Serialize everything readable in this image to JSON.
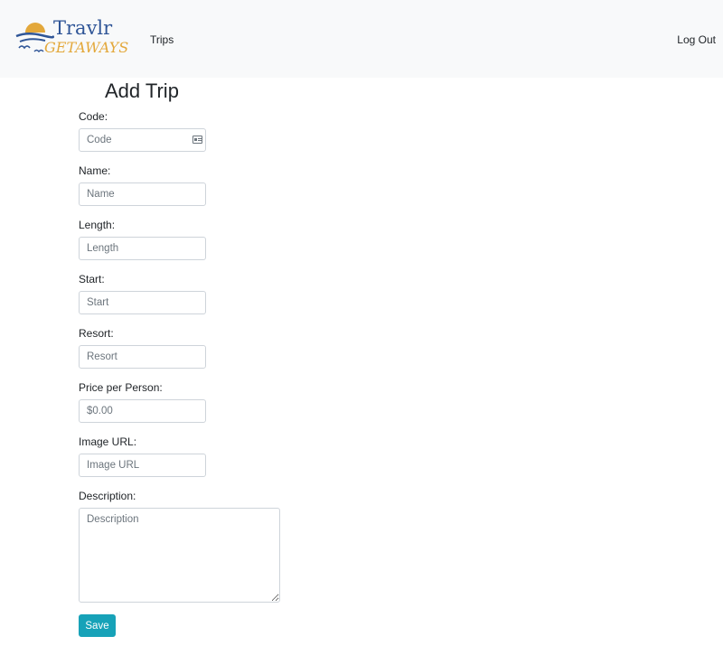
{
  "navbar": {
    "brand": {
      "line1": "Travlr",
      "line2": "GETAWAYS"
    },
    "links": {
      "trips": "Trips",
      "logout": "Log Out"
    }
  },
  "page": {
    "title": "Add Trip"
  },
  "form": {
    "code": {
      "label": "Code:",
      "placeholder": "Code"
    },
    "name": {
      "label": "Name:",
      "placeholder": "Name"
    },
    "length": {
      "label": "Length:",
      "placeholder": "Length"
    },
    "start": {
      "label": "Start:",
      "placeholder": "Start"
    },
    "resort": {
      "label": "Resort:",
      "placeholder": "Resort"
    },
    "price": {
      "label": "Price per Person:",
      "placeholder": "$0.00"
    },
    "image": {
      "label": "Image URL:",
      "placeholder": "Image URL"
    },
    "description": {
      "label": "Description:",
      "placeholder": "Description"
    },
    "save_label": "Save"
  },
  "colors": {
    "navbar_bg": "#f8f9fa",
    "button": "#17a2b8",
    "brand_blue": "#2f5597",
    "brand_gold": "#e3a83b"
  },
  "icons": {
    "autofill": "contact-card-icon",
    "logo": "sun-waves-birds-logo"
  }
}
